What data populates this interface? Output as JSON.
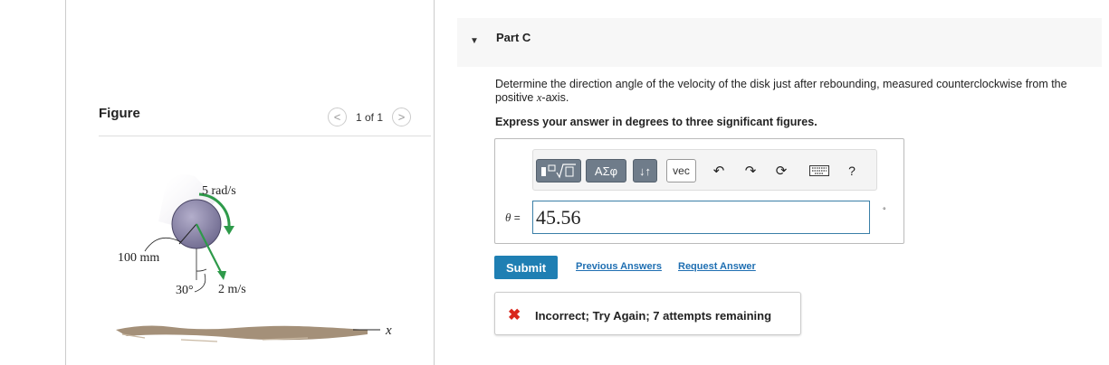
{
  "figure_panel": {
    "title": "Figure",
    "pager": {
      "prev_icon": "<",
      "text": "1 of 1",
      "next_icon": ">"
    },
    "diagram": {
      "angular_velocity_label": "5 rad/s",
      "radius_label": "100 mm",
      "angle_label": "30°",
      "speed_label": "2 m/s",
      "axis_label": "x"
    }
  },
  "part": {
    "caret": "▼",
    "title": "Part C",
    "question_prefix": "Determine the direction angle of the velocity of the disk just after rebounding, measured counterclockwise from the positive ",
    "question_symbol": "x",
    "question_suffix": "-axis.",
    "instruction": "Express your answer in degrees to three significant figures."
  },
  "toolbar": {
    "templates_icon": "templates-icon",
    "greek_label": "ΑΣφ",
    "arrows_label": "↓↑",
    "vec_label": "vec",
    "undo_icon": "↶",
    "redo_icon": "↷",
    "reset_icon": "⟳",
    "keyboard_icon": "keyboard-icon",
    "help_label": "?"
  },
  "answer": {
    "variable": "θ",
    "equals": " =",
    "value": "45.56",
    "unit": "°"
  },
  "actions": {
    "submit_label": "Submit",
    "previous_answers_label": "Previous Answers",
    "request_answer_label": "Request Answer"
  },
  "feedback": {
    "icon": "✖",
    "message": "Incorrect; Try Again; 7 attempts remaining",
    "color": "#d9261c"
  },
  "colors": {
    "accent": "#1f7fb3",
    "link": "#1f6fb2",
    "disk": "#8a84a8",
    "arrow": "#2e9a4a"
  }
}
